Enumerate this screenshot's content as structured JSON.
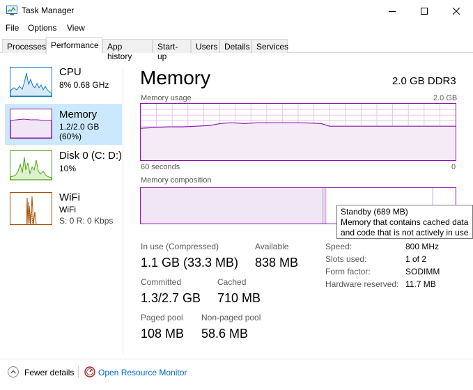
{
  "window": {
    "title": "Task Manager"
  },
  "menu": [
    "File",
    "Options",
    "View"
  ],
  "tabs": [
    "Processes",
    "Performance",
    "App history",
    "Start-up",
    "Users",
    "Details",
    "Services"
  ],
  "active_tab": "Performance",
  "sidebar": {
    "items": [
      {
        "title": "CPU",
        "line1": "8%  0.68 GHz",
        "line2": "",
        "icon": "cpu-graph-icon",
        "color": "#117dbb"
      },
      {
        "title": "Memory",
        "line1": "1.2/2.0 GB (60%)",
        "line2": "",
        "icon": "memory-graph-icon",
        "color": "#8b12ae",
        "selected": true
      },
      {
        "title": "Disk 0 (C: D:)",
        "line1": "10%",
        "line2": "",
        "icon": "disk-graph-icon",
        "color": "#4da60c"
      },
      {
        "title": "WiFi",
        "line1": "WiFi",
        "line2": "S: 0  R: 0 Kbps",
        "icon": "wifi-graph-icon",
        "color": "#a74f01"
      }
    ]
  },
  "main": {
    "title": "Memory",
    "spec": "2.0 GB DDR3",
    "usage_label": "Memory usage",
    "usage_max": "2.0 GB",
    "time_label": "60 seconds",
    "time_end": "0",
    "composition_label": "Memory composition",
    "tooltip": {
      "title": "Standby (689 MB)",
      "line1": "Memory that contains cached data",
      "line2": "and code that is not actively in use"
    },
    "stats": {
      "in_use_label": "In use (Compressed)",
      "in_use_value": "1.1 GB (33.3 MB)",
      "available_label": "Available",
      "available_value": "838 MB",
      "committed_label": "Committed",
      "committed_value": "1.3/2.7 GB",
      "cached_label": "Cached",
      "cached_value": "710 MB",
      "paged_label": "Paged pool",
      "paged_value": "108 MB",
      "nonpaged_label": "Non-paged pool",
      "nonpaged_value": "58.6 MB"
    },
    "specs": {
      "speed_label": "Speed:",
      "speed_value": "800 MHz",
      "slots_label": "Slots used:",
      "slots_value": "1 of 2",
      "form_label": "Form factor:",
      "form_value": "SODIMM",
      "reserved_label": "Hardware reserved:",
      "reserved_value": "11.7 MB"
    }
  },
  "footer": {
    "fewer_details": "Fewer details",
    "resource_monitor": "Open Resource Monitor"
  },
  "colors": {
    "memory_accent": "#8b12ae",
    "grid": "#e6c5ef",
    "selected_bg": "#cce8ff",
    "link": "#0066cc"
  }
}
